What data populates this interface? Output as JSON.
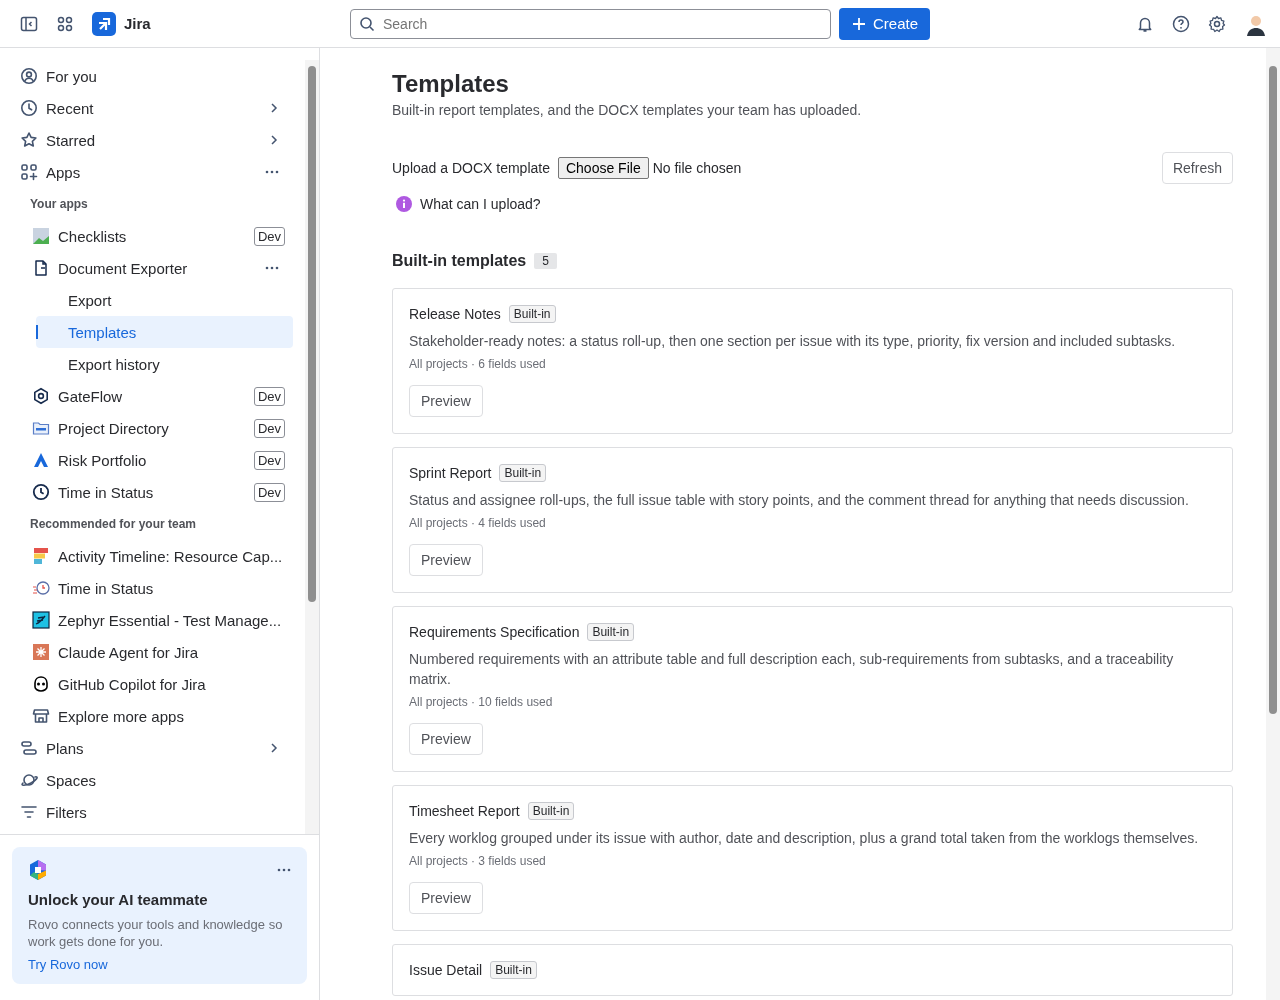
{
  "topbar": {
    "product": "Jira",
    "search": {
      "placeholder": "Search"
    },
    "create_button": "Create"
  },
  "sidebar": {
    "items": [
      {
        "kind": "nav",
        "label": "For you",
        "chevron": false,
        "menu": false,
        "selected": false
      },
      {
        "kind": "nav",
        "label": "Recent",
        "chevron": true,
        "menu": false,
        "selected": false
      },
      {
        "kind": "nav",
        "label": "Starred",
        "chevron": true,
        "menu": false,
        "selected": false
      },
      {
        "kind": "nav",
        "label": "Apps",
        "chevron": false,
        "menu": true,
        "selected": false
      },
      {
        "kind": "heading",
        "label": "Your apps"
      },
      {
        "kind": "app",
        "label": "Checklists",
        "badge": "Dev",
        "chevron": false,
        "menu": false,
        "selected": false
      },
      {
        "kind": "app",
        "label": "Document Exporter",
        "chevron": false,
        "menu": true,
        "selected": false
      },
      {
        "kind": "sub",
        "label": "Export",
        "chevron": false,
        "menu": false,
        "selected": false
      },
      {
        "kind": "sub",
        "label": "Templates",
        "chevron": false,
        "menu": false,
        "selected": true
      },
      {
        "kind": "sub",
        "label": "Export history",
        "chevron": false,
        "menu": false,
        "selected": false
      },
      {
        "kind": "app",
        "label": "GateFlow",
        "badge": "Dev",
        "chevron": false,
        "menu": false,
        "selected": false
      },
      {
        "kind": "app",
        "label": "Project Directory",
        "badge": "Dev",
        "chevron": false,
        "menu": false,
        "selected": false
      },
      {
        "kind": "app",
        "label": "Risk Portfolio",
        "badge": "Dev",
        "chevron": false,
        "menu": false,
        "selected": false
      },
      {
        "kind": "app",
        "label": "Time in Status",
        "badge": "Dev",
        "chevron": false,
        "menu": false,
        "selected": false
      },
      {
        "kind": "heading",
        "label": "Recommended for your team"
      },
      {
        "kind": "app",
        "label": "Activity Timeline: Resource Cap...",
        "chevron": false,
        "menu": false,
        "selected": false
      },
      {
        "kind": "app",
        "label": "Time in Status",
        "chevron": false,
        "menu": false,
        "selected": false
      },
      {
        "kind": "app",
        "label": "Zephyr Essential - Test Manage...",
        "chevron": false,
        "menu": false,
        "selected": false
      },
      {
        "kind": "app",
        "label": "Claude Agent for Jira",
        "chevron": false,
        "menu": false,
        "selected": false
      },
      {
        "kind": "app",
        "label": "GitHub Copilot for Jira",
        "chevron": false,
        "menu": false,
        "selected": false
      },
      {
        "kind": "app",
        "label": "Explore more apps",
        "chevron": false,
        "menu": false,
        "selected": false
      },
      {
        "kind": "nav",
        "label": "Plans",
        "chevron": true,
        "menu": false,
        "selected": false
      },
      {
        "kind": "nav",
        "label": "Spaces",
        "chevron": false,
        "menu": false,
        "selected": false
      },
      {
        "kind": "nav",
        "label": "Filters",
        "chevron": false,
        "menu": false,
        "selected": false
      }
    ],
    "promo": {
      "title": "Unlock your AI teammate",
      "text": "Rovo connects your tools and knowledge so work gets done for you.",
      "link": "Try Rovo now"
    }
  },
  "page": {
    "title": "Templates",
    "subtitle": "Built-in report templates, and the DOCX templates your team has uploaded.",
    "upload": {
      "label": "Upload a DOCX template",
      "file_button": "Choose File",
      "file_status": "No file chosen"
    },
    "refresh_button": "Refresh",
    "help_link": "What can I upload?",
    "section": {
      "title": "Built-in templates",
      "count": "5"
    },
    "cards": [
      {
        "title": "Release Notes",
        "badge": "Built-in",
        "description": "Stakeholder-ready notes: a status roll-up, then one section per issue with its type, priority, fix version and included subtasks.",
        "meta": "All projects · 6 fields used",
        "button": "Preview"
      },
      {
        "title": "Sprint Report",
        "badge": "Built-in",
        "description": "Status and assignee roll-ups, the full issue table with story points, and the comment thread for anything that needs discussion.",
        "meta": "All projects · 4 fields used",
        "button": "Preview"
      },
      {
        "title": "Requirements Specification",
        "badge": "Built-in",
        "description": "Numbered requirements with an attribute table and full description each, sub-requirements from subtasks, and a traceability matrix.",
        "meta": "All projects · 10 fields used",
        "button": "Preview"
      },
      {
        "title": "Timesheet Report",
        "badge": "Built-in",
        "description": "Every worklog grouped under its issue with author, date and description, plus a grand total taken from the worklogs themselves.",
        "meta": "All projects · 3 fields used",
        "button": "Preview"
      },
      {
        "title": "Issue Detail",
        "badge": "Built-in"
      }
    ]
  }
}
